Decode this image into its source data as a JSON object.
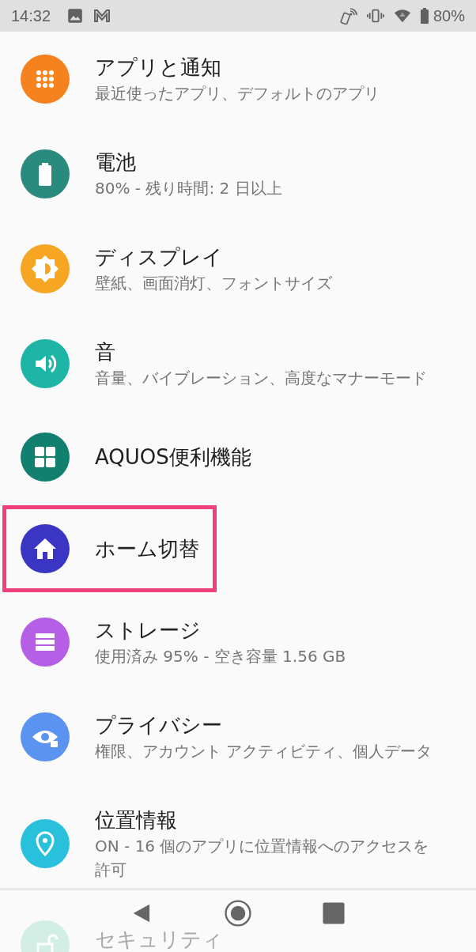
{
  "status_bar": {
    "time": "14:32",
    "battery": "80%"
  },
  "settings": [
    {
      "title": "アプリと通知",
      "subtitle": "最近使ったアプリ、デフォルトのアプリ",
      "color": "#f5821f",
      "highlighted": false
    },
    {
      "title": "電池",
      "subtitle": "80% - 残り時間: 2 日以上",
      "color": "#2a8a7e",
      "highlighted": false
    },
    {
      "title": "ディスプレイ",
      "subtitle": "壁紙、画面消灯、フォントサイズ",
      "color": "#f6a623",
      "highlighted": false
    },
    {
      "title": "音",
      "subtitle": "音量、バイブレーション、高度なマナーモード",
      "color": "#1fb5a6",
      "highlighted": false
    },
    {
      "title": "AQUOS便利機能",
      "color": "#11806f",
      "highlighted": false
    },
    {
      "title": "ホーム切替",
      "color": "#3b35c4",
      "highlighted": true
    },
    {
      "title": "ストレージ",
      "subtitle": "使用済み 95% - 空き容量 1.56 GB",
      "color": "#b55ee6",
      "highlighted": false
    },
    {
      "title": "プライバシー",
      "subtitle": "権限、アカウント アクティビティ、個人データ",
      "color": "#5b93f0",
      "highlighted": false
    },
    {
      "title": "位置情報",
      "subtitle": "ON - 16 個のアプリに位置情報へのアクセスを許可",
      "color": "#29c0dc",
      "highlighted": false
    },
    {
      "title": "セキュリティ",
      "color": "#d3efe5",
      "highlighted": false,
      "faded": true
    }
  ]
}
